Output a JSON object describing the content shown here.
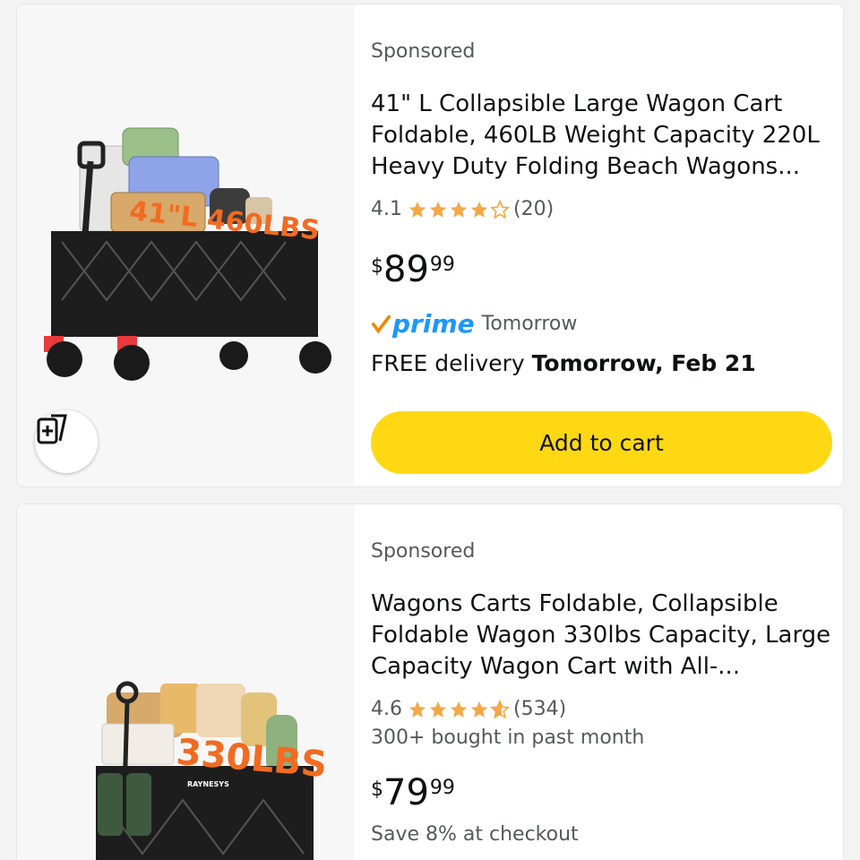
{
  "products": [
    {
      "sponsored_label": "Sponsored",
      "title": "41\" L Collapsible Large Wagon Cart Foldable, 460LB Weight Capacity 220L Heavy Duty Folding Beach Wagons...",
      "rating_value": "4.1",
      "rating_stars": 4.1,
      "review_count": "(20)",
      "price_symbol": "$",
      "price_whole": "89",
      "price_fraction": "99",
      "prime_label": "prime",
      "prime_day": "Tomorrow",
      "delivery_prefix": "FREE delivery ",
      "delivery_date": "Tomorrow, Feb 21",
      "add_to_cart_label": "Add to cart",
      "image_text": "41\"L 460LBS",
      "icon": "compare-icon"
    },
    {
      "sponsored_label": "Sponsored",
      "title": "Wagons Carts Foldable, Collapsible Foldable Wagon 330lbs Capacity, Large Capacity Wagon Cart with All-...",
      "rating_value": "4.6",
      "rating_stars": 4.6,
      "review_count": "(534)",
      "bought_text": "300+ bought in past month",
      "price_symbol": "$",
      "price_whole": "79",
      "price_fraction": "99",
      "save_text": "Save 8% at checkout",
      "image_text": "330LBS",
      "brand_text": "RAYNESYS"
    }
  ],
  "colors": {
    "star": "#f3a847",
    "prime_blue": "#1a98ff",
    "prime_check": "#f08804",
    "add_button": "#ffd814",
    "secondary_text": "#565959"
  }
}
